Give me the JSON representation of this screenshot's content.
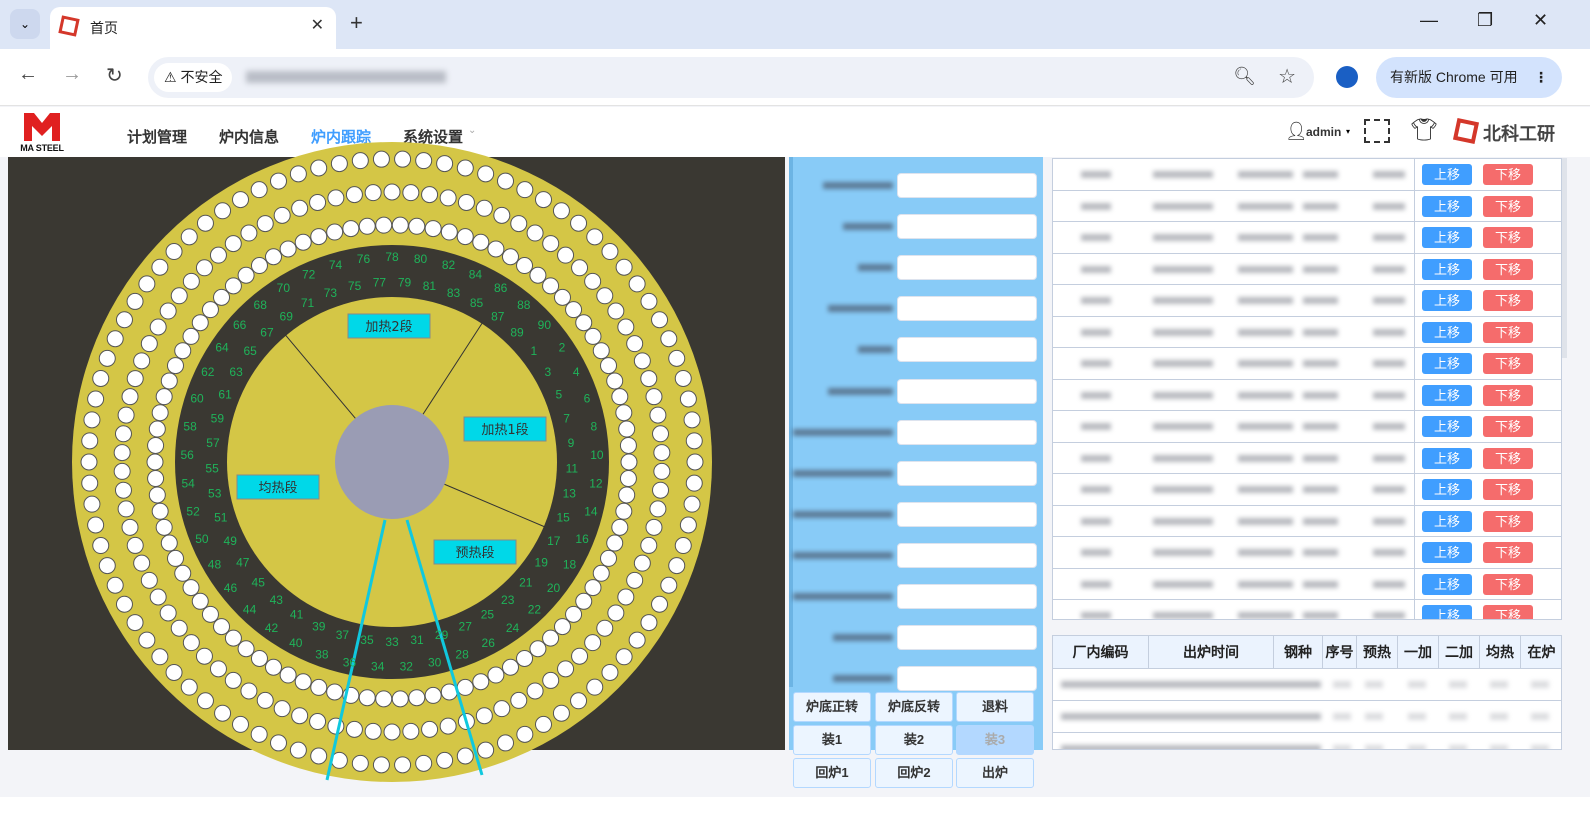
{
  "browser": {
    "tab_title": "首页",
    "security_label": "不安全",
    "update_label": "有新版 Chrome 可用"
  },
  "app": {
    "logo_text": "MA STEEL",
    "menu": [
      {
        "label": "计划管理"
      },
      {
        "label": "炉内信息"
      },
      {
        "label": "炉内跟踪",
        "active": true
      },
      {
        "label": "系统设置"
      }
    ],
    "user": "admin",
    "brand": "北科工研"
  },
  "furnace": {
    "zones": [
      {
        "label": "加热2段"
      },
      {
        "label": "加热1段"
      },
      {
        "label": "均热段"
      },
      {
        "label": "预热段"
      }
    ],
    "position_numbers": {
      "from": 1,
      "to": 90
    },
    "colors": {
      "hearth": "#d4c646",
      "track": "#3a3832",
      "number": "#1fb35a",
      "center": "#9a9cb4",
      "zone_label": "#00d8e8"
    }
  },
  "controls": {
    "buttons": [
      "炉底正转",
      "炉底反转",
      "退料",
      "装1",
      "装2",
      "装3",
      "回炉1",
      "回炉2",
      "出炉"
    ]
  },
  "queue_table": {
    "up_label": "上移",
    "down_label": "下移",
    "row_count": 15
  },
  "furnace_table": {
    "headers": [
      "厂内编码",
      "出炉时间",
      "钢种",
      "序号",
      "预热",
      "一加",
      "二加",
      "均热",
      "在炉"
    ]
  }
}
